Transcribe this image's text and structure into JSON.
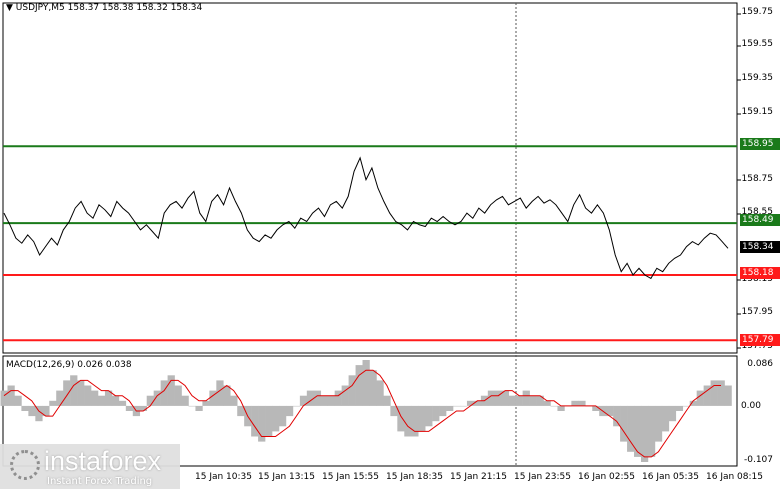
{
  "header": {
    "triangle": "▼",
    "symbol": "USDJPY,M5",
    "ohlc": "158.37 158.38 158.32 158.34"
  },
  "macd_header": "MACD(12,26,9) 0.026 0.038",
  "price_axis": [
    "159.75",
    "159.55",
    "159.35",
    "159.15",
    "158.75",
    "158.55",
    "157.95",
    "157.75"
  ],
  "price_axis_partial": "158.15",
  "levels": [
    {
      "value": "158.95",
      "color": "#1a7a1a"
    },
    {
      "value": "158.49",
      "color": "#1a7a1a"
    },
    {
      "value": "158.18",
      "color": "#ff1a1a"
    },
    {
      "value": "157.79",
      "color": "#ff1a1a"
    }
  ],
  "current_price": "158.34",
  "macd_axis": [
    "0.086",
    "0.00",
    "-0.107"
  ],
  "time_axis": [
    "15 Jan 10:35",
    "15 Jan 13:15",
    "15 Jan 15:55",
    "15 Jan 18:35",
    "15 Jan 21:15",
    "15 Jan 23:55",
    "16 Jan 02:55",
    "16 Jan 05:35",
    "16 Jan 08:15"
  ],
  "logo": {
    "name": "instaforex",
    "tagline": "Instant Forex Trading"
  },
  "chart_data": {
    "type": "line",
    "price_series": [
      158.55,
      158.48,
      158.4,
      158.37,
      158.42,
      158.38,
      158.3,
      158.35,
      158.4,
      158.36,
      158.45,
      158.5,
      158.58,
      158.62,
      158.55,
      158.52,
      158.6,
      158.57,
      158.53,
      158.62,
      158.58,
      158.55,
      158.5,
      158.45,
      158.48,
      158.44,
      158.4,
      158.55,
      158.6,
      158.62,
      158.58,
      158.64,
      158.68,
      158.55,
      158.5,
      158.62,
      158.66,
      158.6,
      158.7,
      158.62,
      158.55,
      158.45,
      158.4,
      158.38,
      158.42,
      158.4,
      158.45,
      158.48,
      158.5,
      158.46,
      158.52,
      158.5,
      158.55,
      158.58,
      158.53,
      158.6,
      158.62,
      158.58,
      158.65,
      158.8,
      158.88,
      158.75,
      158.82,
      158.7,
      158.62,
      158.55,
      158.5,
      158.48,
      158.45,
      158.5,
      158.48,
      158.47,
      158.52,
      158.5,
      158.53,
      158.5,
      158.48,
      158.5,
      158.55,
      158.52,
      158.58,
      158.55,
      158.6,
      158.63,
      158.65,
      158.6,
      158.62,
      158.64,
      158.58,
      158.62,
      158.65,
      158.61,
      158.63,
      158.6,
      158.55,
      158.5,
      158.6,
      158.66,
      158.58,
      158.55,
      158.6,
      158.55,
      158.45,
      158.3,
      158.2,
      158.25,
      158.18,
      158.22,
      158.18,
      158.16,
      158.22,
      158.2,
      158.25,
      158.28,
      158.3,
      158.35,
      158.38,
      158.36,
      158.4,
      158.43,
      158.42,
      158.38,
      158.34
    ],
    "levels": [
      158.95,
      158.49,
      158.18,
      157.79
    ],
    "ylim": [
      157.72,
      159.8
    ],
    "macd_hist": [
      0.03,
      0.04,
      0.02,
      -0.01,
      -0.02,
      -0.03,
      -0.02,
      0.01,
      0.03,
      0.05,
      0.06,
      0.05,
      0.04,
      0.03,
      0.02,
      0.03,
      0.02,
      0.01,
      -0.01,
      -0.02,
      -0.01,
      0.02,
      0.03,
      0.05,
      0.06,
      0.04,
      0.02,
      0.0,
      -0.01,
      0.01,
      0.03,
      0.05,
      0.04,
      0.02,
      -0.02,
      -0.04,
      -0.06,
      -0.07,
      -0.06,
      -0.05,
      -0.04,
      -0.02,
      0.0,
      0.02,
      0.03,
      0.03,
      0.02,
      0.02,
      0.03,
      0.04,
      0.06,
      0.08,
      0.09,
      0.07,
      0.05,
      0.02,
      -0.02,
      -0.05,
      -0.06,
      -0.06,
      -0.05,
      -0.04,
      -0.03,
      -0.02,
      -0.01,
      0.0,
      0.0,
      0.01,
      0.01,
      0.02,
      0.03,
      0.03,
      0.03,
      0.02,
      0.02,
      0.03,
      0.02,
      0.02,
      0.01,
      0.0,
      -0.01,
      0.0,
      0.01,
      0.01,
      0.0,
      -0.01,
      -0.02,
      -0.02,
      -0.04,
      -0.07,
      -0.09,
      -0.1,
      -0.11,
      -0.1,
      -0.07,
      -0.05,
      -0.03,
      -0.01,
      0.0,
      0.01,
      0.03,
      0.04,
      0.05,
      0.05,
      0.04
    ],
    "macd_signal": [
      0.02,
      0.03,
      0.03,
      0.02,
      0.01,
      -0.01,
      -0.02,
      -0.02,
      0.0,
      0.02,
      0.04,
      0.05,
      0.05,
      0.04,
      0.03,
      0.03,
      0.02,
      0.02,
      0.01,
      -0.01,
      -0.01,
      0.0,
      0.02,
      0.03,
      0.05,
      0.05,
      0.04,
      0.02,
      0.01,
      0.01,
      0.02,
      0.03,
      0.04,
      0.03,
      0.01,
      -0.02,
      -0.04,
      -0.06,
      -0.06,
      -0.06,
      -0.05,
      -0.04,
      -0.02,
      0.0,
      0.01,
      0.02,
      0.02,
      0.02,
      0.02,
      0.03,
      0.04,
      0.06,
      0.07,
      0.07,
      0.06,
      0.04,
      0.01,
      -0.02,
      -0.04,
      -0.05,
      -0.05,
      -0.05,
      -0.04,
      -0.03,
      -0.02,
      -0.01,
      -0.01,
      0.0,
      0.01,
      0.01,
      0.02,
      0.02,
      0.03,
      0.03,
      0.02,
      0.02,
      0.02,
      0.02,
      0.01,
      0.01,
      0.0,
      0.0,
      0.0,
      0.0,
      0.0,
      0.0,
      -0.01,
      -0.02,
      -0.03,
      -0.05,
      -0.07,
      -0.09,
      -0.1,
      -0.1,
      -0.09,
      -0.07,
      -0.05,
      -0.03,
      -0.01,
      0.01,
      0.02,
      0.03,
      0.04,
      0.04
    ]
  }
}
